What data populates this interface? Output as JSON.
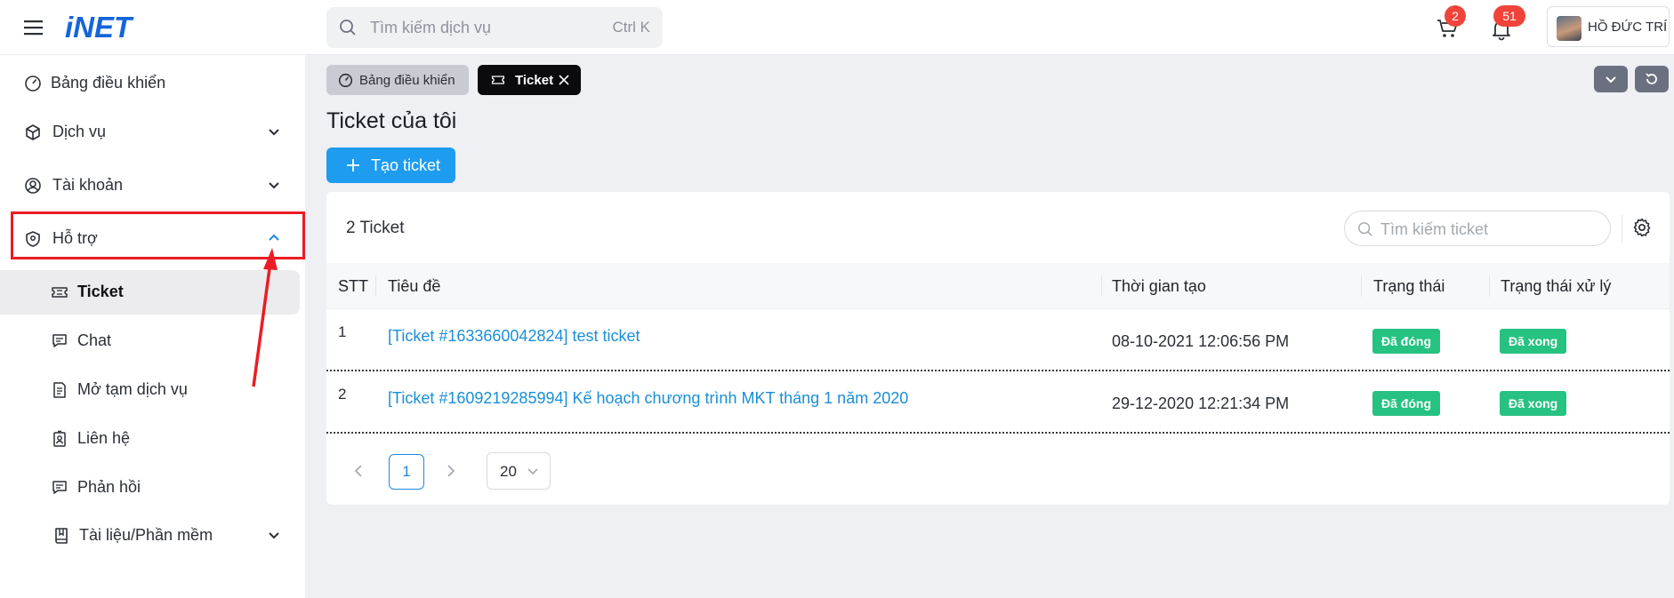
{
  "header": {
    "logo_text": "iNET",
    "search_placeholder": "Tìm kiếm dịch vụ",
    "search_shortcut": "Ctrl K",
    "cart_count": "2",
    "notification_count": "51",
    "user_name": "HỒ ĐỨC TRÍ"
  },
  "sidebar": {
    "items": [
      {
        "label": "Bảng điều khiển",
        "icon": "dashboard-icon"
      },
      {
        "label": "Dịch vụ",
        "icon": "cube-icon"
      },
      {
        "label": "Tài khoản",
        "icon": "user-circle-icon"
      },
      {
        "label": "Hỗ trợ",
        "icon": "support-shield-icon"
      },
      {
        "label": "Tài liệu/Phần mềm",
        "icon": "book-icon"
      }
    ],
    "support_sub_items": [
      {
        "label": "Ticket",
        "icon": "ticket-icon"
      },
      {
        "label": "Chat",
        "icon": "chat-icon"
      },
      {
        "label": "Mở tạm dịch vụ",
        "icon": "document-icon"
      },
      {
        "label": "Liên hệ",
        "icon": "contact-icon"
      },
      {
        "label": "Phản hồi",
        "icon": "feedback-icon"
      }
    ]
  },
  "tabs": [
    {
      "label": "Bảng điều khiển"
    },
    {
      "label": "Ticket"
    }
  ],
  "page": {
    "title": "Ticket của tôi",
    "create_button": "Tạo ticket",
    "count_text": "2 Ticket",
    "table_search_placeholder": "Tìm kiếm  ticket"
  },
  "table": {
    "columns": [
      "STT",
      "Tiêu đề",
      "Thời gian tạo",
      "Trạng thái",
      "Trạng thái xử lý"
    ],
    "rows": [
      {
        "stt": "1",
        "title": "[Ticket #1633660042824] test ticket",
        "created": "08-10-2021 12:06:56 PM",
        "status": "Đã đóng",
        "process": "Đã xong"
      },
      {
        "stt": "2",
        "title": "[Ticket #1609219285994] Kế hoạch chương trình MKT tháng 1 năm 2020",
        "created": "29-12-2020 12:21:34 PM",
        "status": "Đã đóng",
        "process": "Đã xong"
      }
    ]
  },
  "pagination": {
    "current_page": "1",
    "page_size": "20"
  },
  "colors": {
    "brand_blue": "#1565d8",
    "primary_button": "#1e9cf0",
    "status_green": "#26c281",
    "badge_red": "#f0443a",
    "annotation_red": "#ec1c24"
  }
}
